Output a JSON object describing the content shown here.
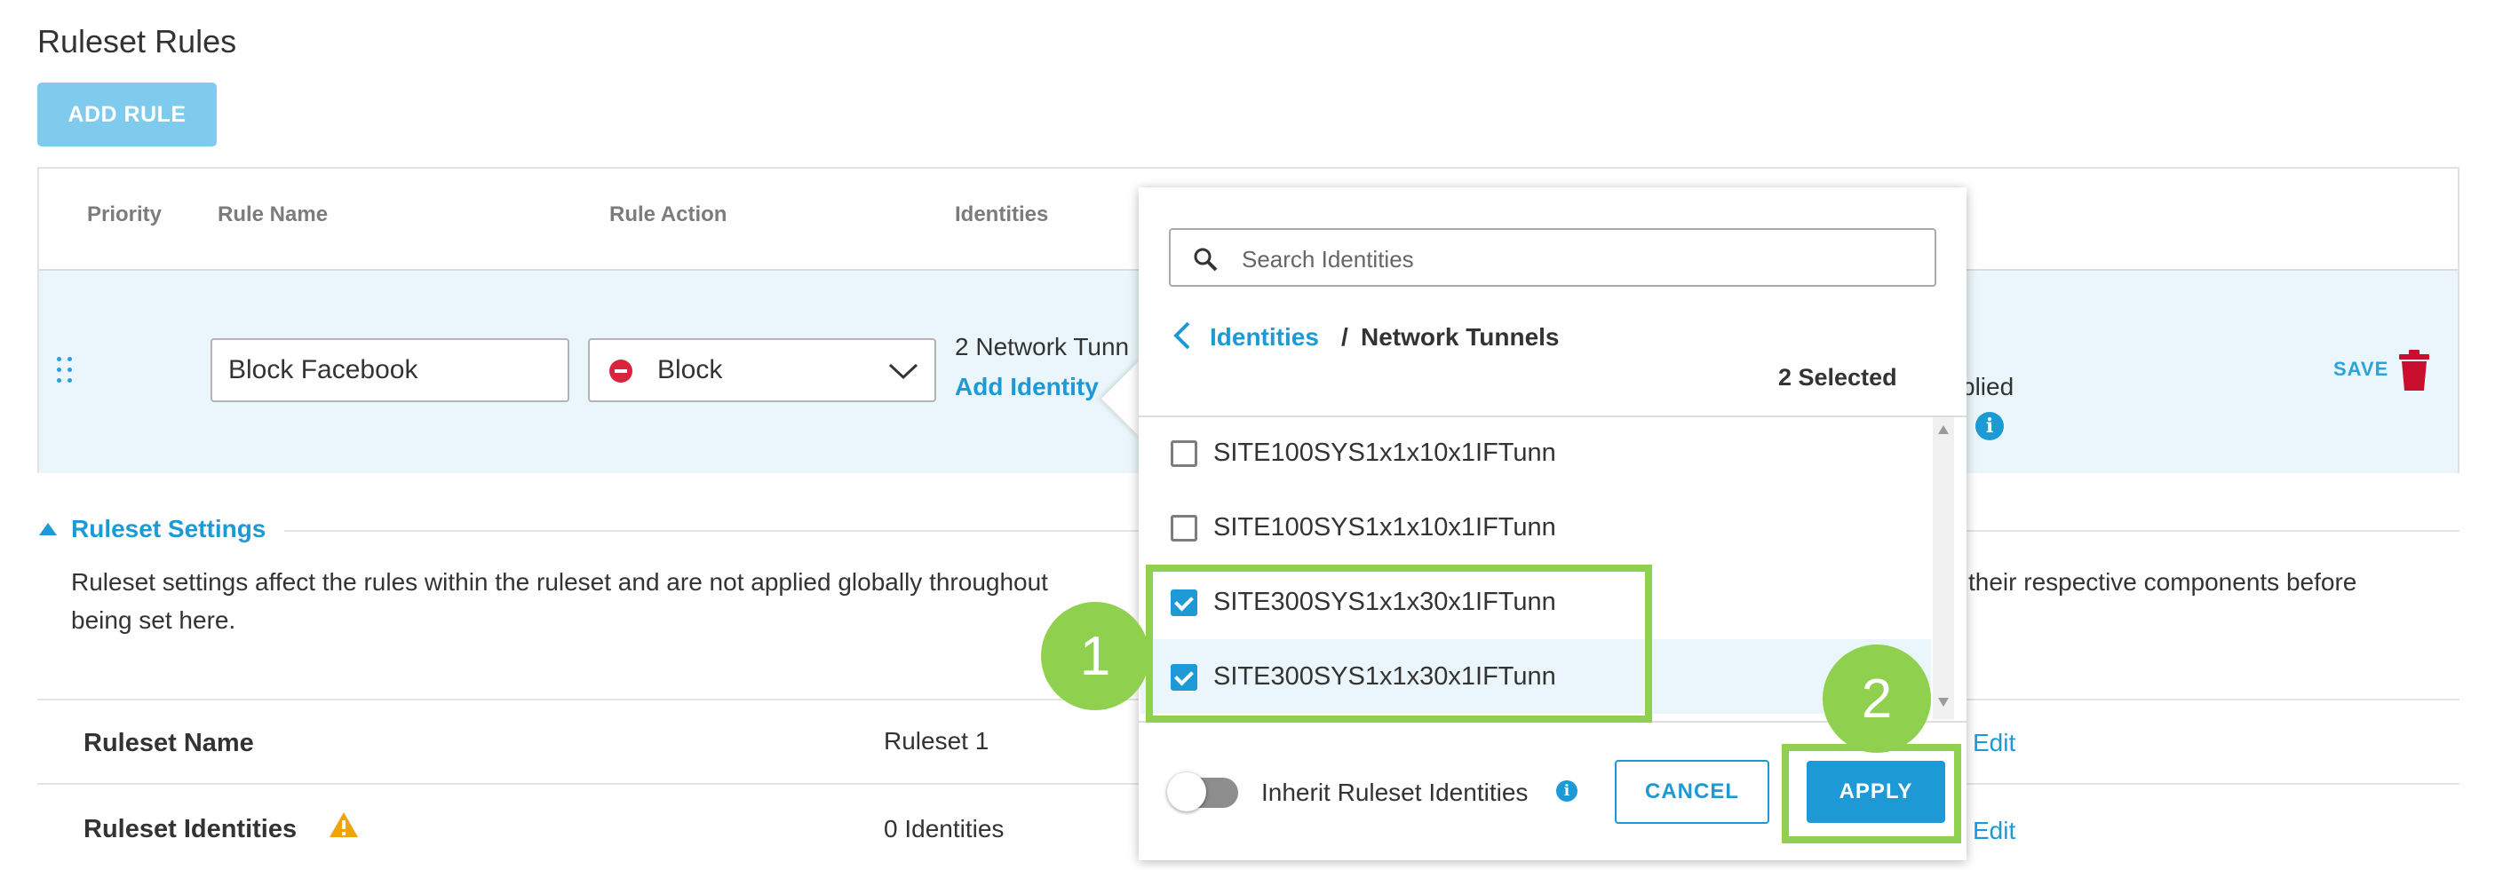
{
  "page": {
    "title": "Ruleset Rules",
    "add_rule_label": "ADD RULE"
  },
  "table": {
    "headers": {
      "priority": "Priority",
      "rule_name": "Rule Name",
      "rule_action": "Rule Action",
      "identities": "Identities"
    },
    "row": {
      "rule_name_value": "Block Facebook",
      "action_value": "Block",
      "identities_summary": "2 Network Tunn",
      "add_identity_label": "Add Identity",
      "applied_text": "plied",
      "applied_text2": "l",
      "save_label": "SAVE"
    }
  },
  "settings": {
    "title": "Ruleset Settings",
    "description_start": "Ruleset settings affect the rules within the ruleset and are not applied globally throughout",
    "description_end": "their respective components before",
    "description_line2": "being set here.",
    "rows": [
      {
        "label": "Ruleset Name",
        "value": "Ruleset 1",
        "action": "Edit"
      },
      {
        "label": "Ruleset Identities",
        "value": "0 Identities",
        "action": "Edit"
      }
    ]
  },
  "popover": {
    "search_placeholder": "Search Identities",
    "breadcrumb_link": "Identities",
    "breadcrumb_sep": "/",
    "breadcrumb_current": "Network Tunnels",
    "selected_count": "2 Selected",
    "items": [
      {
        "label": "SITE100SYS1x1x10x1IFTunn",
        "checked": false
      },
      {
        "label": "SITE100SYS1x1x10x1IFTunn",
        "checked": false
      },
      {
        "label": "SITE300SYS1x1x30x1IFTunn",
        "checked": true
      },
      {
        "label": "SITE300SYS1x1x30x1IFTunn",
        "checked": true
      }
    ],
    "inherit_label": "Inherit Ruleset Identities",
    "inherit_enabled": false,
    "cancel_label": "CANCEL",
    "apply_label": "APPLY"
  },
  "callouts": {
    "step1": "1",
    "step2": "2"
  },
  "colors": {
    "accent": "#1d9ad6",
    "add_rule_bg": "#7fcbed",
    "block_red": "#d8253c",
    "highlight_green": "#8fd14f",
    "warning": "#f0a30a"
  },
  "icons": {
    "drag": "drag-handle-icon",
    "block": "block-icon",
    "dropdown": "chevron-down-icon",
    "trash": "trash-icon",
    "info": "info-icon",
    "search": "search-icon",
    "back": "chevron-left-icon",
    "warning": "warning-icon"
  }
}
